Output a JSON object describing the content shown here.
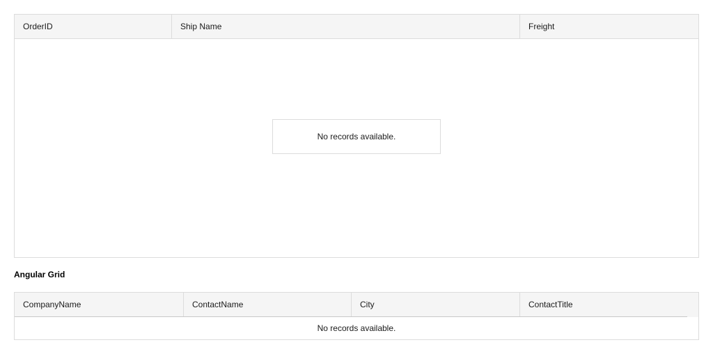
{
  "orders_grid": {
    "columns": [
      "OrderID",
      "Ship Name",
      "Freight"
    ],
    "empty_message": "No records available."
  },
  "section": {
    "title": "Angular Grid"
  },
  "customers_grid": {
    "columns": [
      "CompanyName",
      "ContactName",
      "City",
      "ContactTitle"
    ],
    "empty_message": "No records available."
  }
}
